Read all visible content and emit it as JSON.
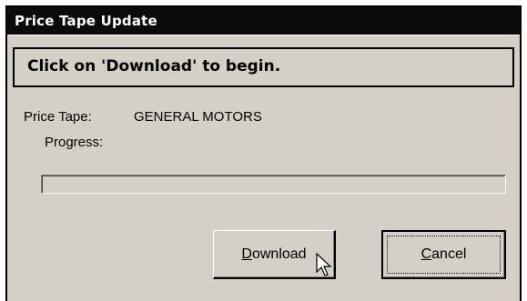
{
  "window": {
    "title": "Price Tape Update"
  },
  "banner": {
    "text": "Click on 'Download' to begin."
  },
  "fields": {
    "price_tape_label": "Price Tape:",
    "price_tape_value": "GENERAL MOTORS",
    "progress_label": "Progress:",
    "progress_fraction": 0
  },
  "buttons": {
    "download": {
      "mnemonic": "D",
      "rest": "ownload"
    },
    "cancel": {
      "mnemonic": "C",
      "rest": "ancel"
    }
  },
  "colors": {
    "window_bg": "#d4d0c8",
    "titlebar_bg": "#0a0a0a",
    "titlebar_text": "#ffffff",
    "progress_fill": "#000080"
  },
  "icons": {
    "cursor": "mouse-pointer-icon"
  }
}
